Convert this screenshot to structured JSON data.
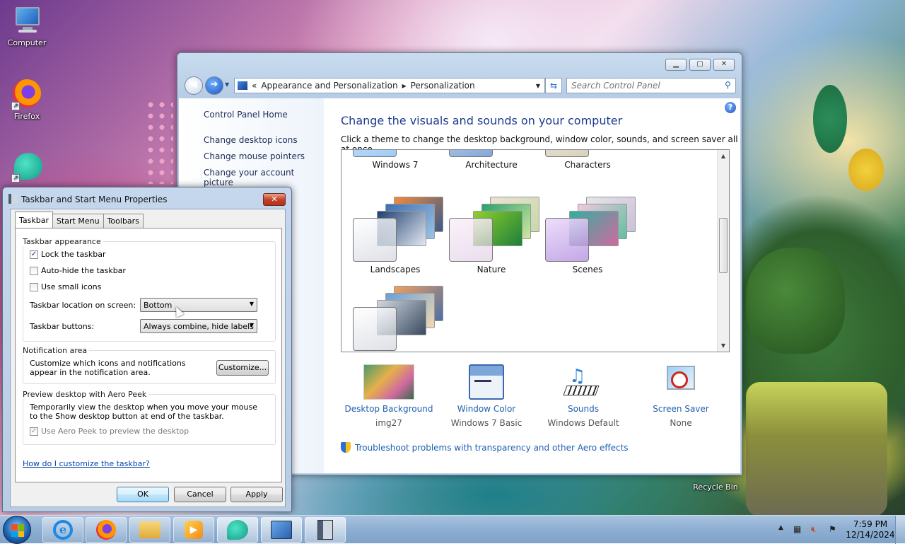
{
  "desktop": {
    "icons": [
      {
        "label": "Computer",
        "icon": "computer-icon"
      },
      {
        "label": "Firefox",
        "icon": "firefox-icon"
      },
      {
        "label": "",
        "icon": "chat-app-icon"
      },
      {
        "label": "Recycle Bin",
        "icon": "recycle-bin-icon"
      }
    ]
  },
  "control_panel": {
    "address": {
      "sep": "«",
      "crumb1": "Appearance and Personalization",
      "arrow": "▸",
      "crumb2": "Personalization"
    },
    "search_placeholder": "Search Control Panel",
    "left_nav": {
      "home": "Control Panel Home",
      "links": [
        "Change desktop icons",
        "Change mouse pointers",
        "Change your account picture"
      ]
    },
    "title": "Change the visuals and sounds on your computer",
    "subtitle": "Click a theme to change the desktop background, window color, sounds, and screen saver all at once.",
    "themes": [
      "Windows 7",
      "Architecture",
      "Characters",
      "Landscapes",
      "Nature",
      "Scenes",
      ""
    ],
    "bottom": [
      {
        "link": "Desktop Background",
        "value": "img27"
      },
      {
        "link": "Window Color",
        "value": "Windows 7 Basic"
      },
      {
        "link": "Sounds",
        "value": "Windows Default"
      },
      {
        "link": "Screen Saver",
        "value": "None"
      }
    ],
    "troubleshoot": "Troubleshoot problems with transparency and other Aero effects"
  },
  "dialog": {
    "title": "Taskbar and Start Menu Properties",
    "tabs": [
      "Taskbar",
      "Start Menu",
      "Toolbars"
    ],
    "appearance": {
      "label": "Taskbar appearance",
      "lock": "Lock the taskbar",
      "lock_checked": true,
      "autohide": "Auto-hide the taskbar",
      "autohide_checked": false,
      "small": "Use small icons",
      "small_checked": false,
      "location_label": "Taskbar location on screen:",
      "location_value": "Bottom",
      "buttons_label": "Taskbar buttons:",
      "buttons_value": "Always combine, hide labels"
    },
    "notification": {
      "label": "Notification area",
      "text": "Customize which icons and notifications appear in the notification area.",
      "button": "Customize..."
    },
    "peek": {
      "label": "Preview desktop with Aero Peek",
      "text": "Temporarily view the desktop when you move your mouse to the Show desktop button at end of the taskbar.",
      "check": "Use Aero Peek to preview the desktop",
      "check_checked": true
    },
    "help_link": "How do I customize the taskbar?",
    "ok": "OK",
    "cancel": "Cancel",
    "apply": "Apply"
  },
  "taskbar": {
    "apps": [
      "ie-icon",
      "firefox-icon",
      "explorer-icon",
      "media-player-icon",
      "chat-app-icon",
      "control-panel-icon",
      "taskbar-properties-icon"
    ],
    "time": "7:59 PM",
    "date": "12/14/2024"
  }
}
